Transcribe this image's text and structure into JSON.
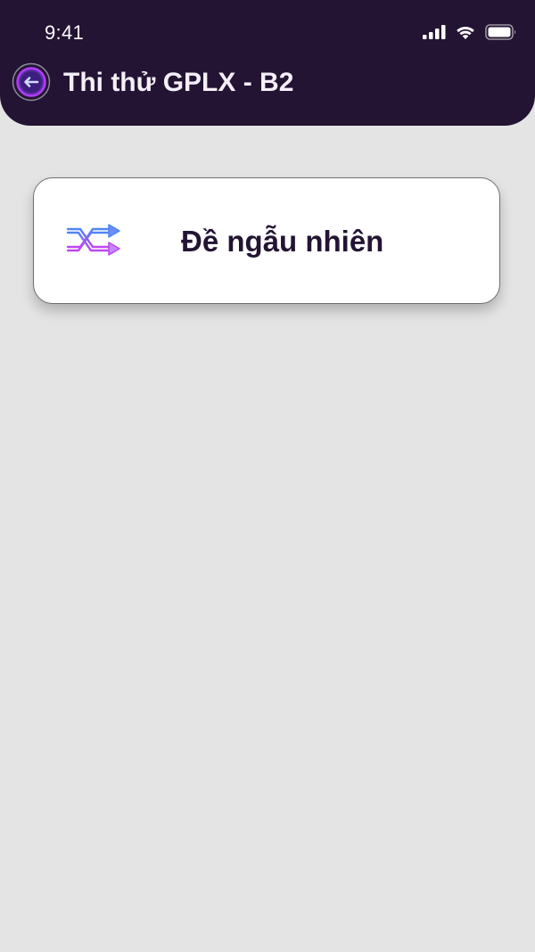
{
  "status_bar": {
    "time": "9:41",
    "icons": [
      "signal-icon",
      "wifi-icon",
      "battery-icon"
    ]
  },
  "header": {
    "title": "Thi thử GPLX - B2",
    "back_icon": "back-arrow-icon",
    "background": "#231433"
  },
  "main": {
    "cards": [
      {
        "label": "Đề ngẫu nhiên",
        "icon": "shuffle-icon"
      }
    ]
  },
  "colors": {
    "page_background": "#e4e4e4",
    "card_text": "#231433",
    "icon_gradient_start": "#4f86f7",
    "icon_gradient_end": "#c046f0"
  }
}
